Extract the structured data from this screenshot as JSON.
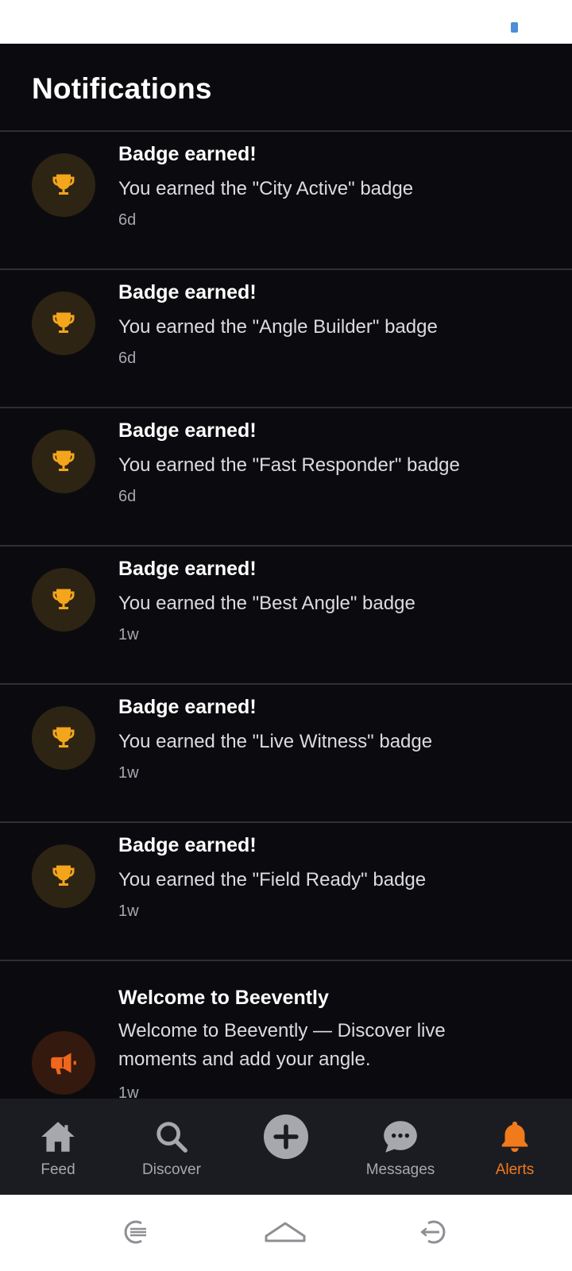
{
  "screen": {
    "title": "Notifications"
  },
  "notifications": [
    {
      "title": "Badge earned!",
      "message": "You earned the \"City Active\" badge",
      "time": "6d",
      "icon": "trophy-icon"
    },
    {
      "title": "Badge earned!",
      "message": "You earned the \"Angle Builder\" badge",
      "time": "6d",
      "icon": "trophy-icon"
    },
    {
      "title": "Badge earned!",
      "message": "You earned the \"Fast Responder\" badge",
      "time": "6d",
      "icon": "trophy-icon"
    },
    {
      "title": "Badge earned!",
      "message": "You earned the \"Best Angle\" badge",
      "time": "1w",
      "icon": "trophy-icon"
    },
    {
      "title": "Badge earned!",
      "message": "You earned the \"Live Witness\" badge",
      "time": "1w",
      "icon": "trophy-icon"
    },
    {
      "title": "Badge earned!",
      "message": "You earned the \"Field Ready\" badge",
      "time": "1w",
      "icon": "trophy-icon"
    },
    {
      "title": "Welcome to Beevently",
      "message": "Welcome to Beevently — Discover live moments and add your angle.",
      "time": "1w",
      "icon": "megaphone-icon"
    }
  ],
  "nav": {
    "items": [
      {
        "label": "Feed",
        "icon": "home-icon"
      },
      {
        "label": "Discover",
        "icon": "search-icon"
      },
      {
        "label": "",
        "icon": "plus-circle-icon"
      },
      {
        "label": "Messages",
        "icon": "chat-bubble-icon"
      },
      {
        "label": "Alerts",
        "icon": "bell-icon",
        "active": true
      }
    ]
  },
  "colors": {
    "background": "#0b0b0f",
    "accent": "#f07a1c",
    "trophy": "#f3a51b",
    "nav_background": "#1b1c21"
  }
}
